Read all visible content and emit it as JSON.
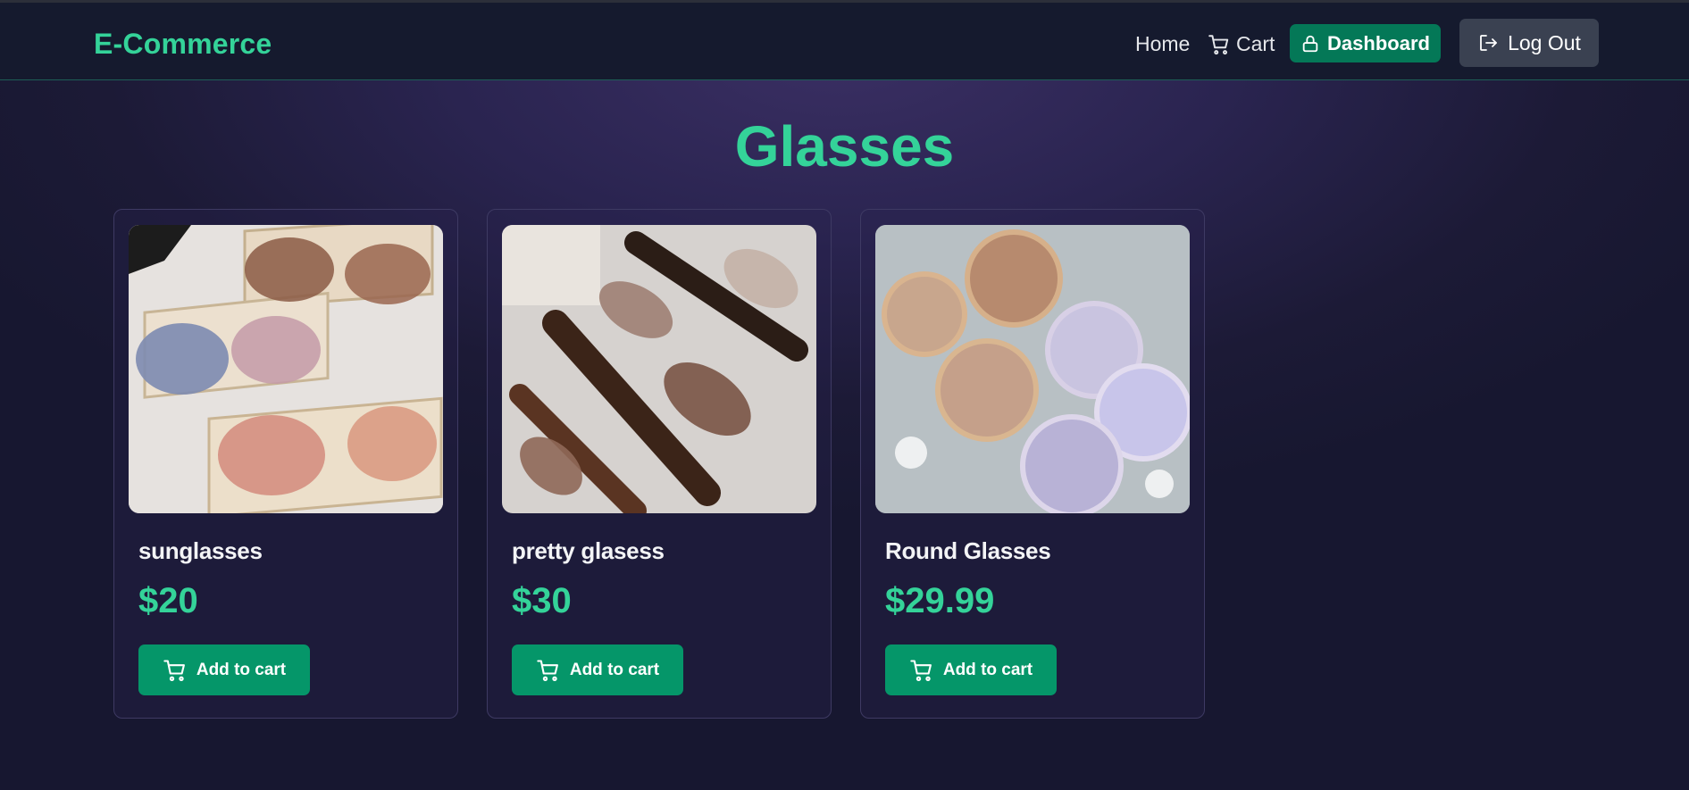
{
  "header": {
    "brand": "E-Commerce",
    "nav": {
      "home": "Home",
      "cart": "Cart"
    },
    "dashboard_label": "Dashboard",
    "logout_label": "Log Out",
    "icons": {
      "cart": "cart-icon",
      "dashboard": "lock-icon",
      "logout": "logout-icon"
    }
  },
  "page": {
    "title": "Glasses"
  },
  "products": [
    {
      "name": "sunglasses",
      "price": "$20",
      "button": "Add to cart",
      "image": "sunglasses-photo"
    },
    {
      "name": "pretty glasess",
      "price": "$30",
      "button": "Add to cart",
      "image": "pretty-glasses-photo"
    },
    {
      "name": "Round Glasses",
      "price": "$29.99",
      "button": "Add to cart",
      "image": "round-glasses-photo"
    }
  ],
  "colors": {
    "accent": "#34d399",
    "button": "#059669",
    "dashboard": "#047857",
    "logout": "#3a4151",
    "header_bg": "#151a2e"
  }
}
